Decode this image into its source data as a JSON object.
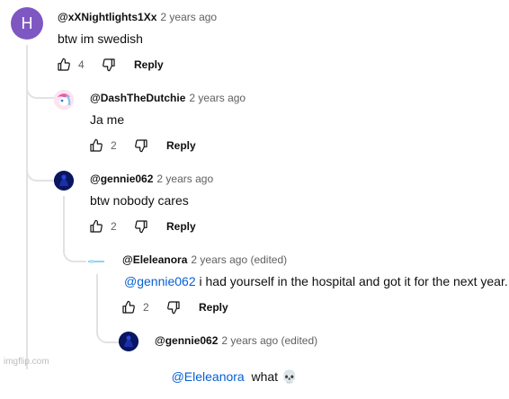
{
  "comments": [
    {
      "avatar": {
        "letter": "H",
        "color": "#7e57c2"
      },
      "author": "@xXNightlights1Xx",
      "time": "2 years ago",
      "mention": "",
      "text": "btw im swedish",
      "likes": "4",
      "reply_label": "Reply"
    },
    {
      "avatar": {
        "color": "#f5b6d6"
      },
      "author": "@DashTheDutchie",
      "time": "2 years ago",
      "mention": "",
      "text": "Ja me",
      "likes": "2",
      "reply_label": "Reply"
    },
    {
      "avatar": {
        "color": "#0b1a6e"
      },
      "author": "@gennie062",
      "time": "2 years ago",
      "mention": "",
      "text": "btw nobody cares",
      "likes": "2",
      "reply_label": "Reply"
    },
    {
      "avatar": {
        "color": "#8fd3f4"
      },
      "author": "@Eleleanora",
      "time": "2 years ago (edited)",
      "mention": "@gennie062",
      "text": " i had yourself in the hospital and got it for the next year.",
      "likes": "2",
      "reply_label": "Reply"
    },
    {
      "avatar": {
        "color": "#0b1a6e"
      },
      "author": "@gennie062",
      "time": "2 years ago (edited)",
      "mention": "@Eleleanora",
      "text": "  what 💀",
      "likes": "",
      "reply_label": ""
    }
  ],
  "watermark": "imgflip.com"
}
